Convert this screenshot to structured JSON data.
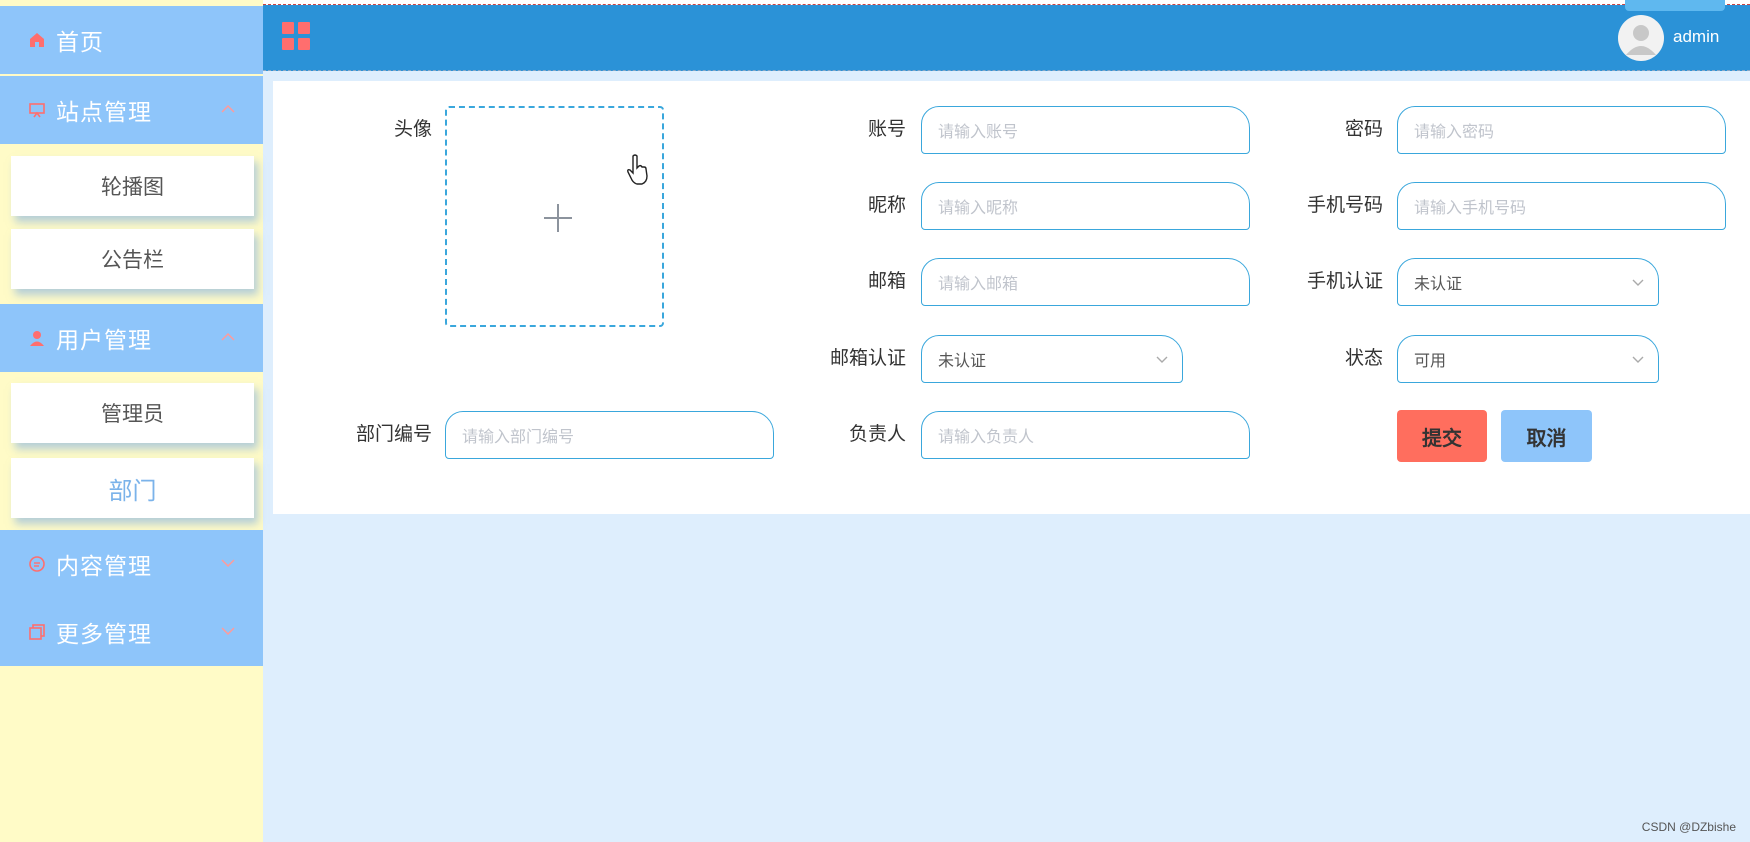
{
  "sidebar": {
    "home": "首页",
    "site_mgmt": "站点管理",
    "site_sub": [
      "轮播图",
      "公告栏"
    ],
    "user_mgmt": "用户管理",
    "user_sub": [
      "管理员",
      "部门"
    ],
    "content_mgmt": "内容管理",
    "more_mgmt": "更多管理",
    "active_item": "部门"
  },
  "header": {
    "username": "admin"
  },
  "form": {
    "avatar_label": "头像",
    "account_label": "账号",
    "account_placeholder": "请输入账号",
    "password_label": "密码",
    "password_placeholder": "请输入密码",
    "nickname_label": "昵称",
    "nickname_placeholder": "请输入昵称",
    "phone_label": "手机号码",
    "phone_placeholder": "请输入手机号码",
    "email_label": "邮箱",
    "email_placeholder": "请输入邮箱",
    "phone_verify_label": "手机认证",
    "phone_verify_value": "未认证",
    "email_verify_label": "邮箱认证",
    "email_verify_value": "未认证",
    "status_label": "状态",
    "status_value": "可用",
    "dept_no_label": "部门编号",
    "dept_no_placeholder": "请输入部门编号",
    "leader_label": "负责人",
    "leader_placeholder": "请输入负责人",
    "submit_label": "提交",
    "cancel_label": "取消"
  },
  "footer": {
    "watermark": "CSDN @DZbishe"
  },
  "colors": {
    "sidebar_menu": "#8ec5fa",
    "sidebar_bg": "#fffbc7",
    "header": "#2b92d7",
    "accent_red": "#ff6e5e",
    "input_border": "#3aa7dc",
    "page_bg": "#deeefd"
  }
}
